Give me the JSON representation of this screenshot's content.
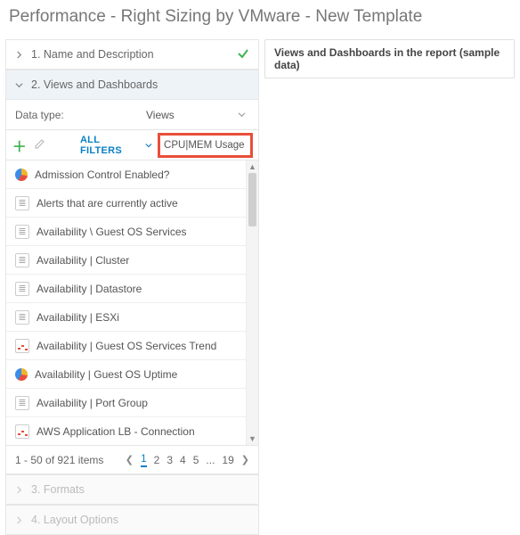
{
  "page_title": "Performance - Right Sizing by VMware - New Template",
  "right_panel_header": "Views and Dashboards in the report (sample data)",
  "steps": {
    "s1": {
      "label": "1. Name and Description",
      "complete": true,
      "expanded": false
    },
    "s2": {
      "label": "2. Views and Dashboards",
      "complete": false,
      "expanded": true
    },
    "s3": {
      "label": "3. Formats"
    },
    "s4": {
      "label": "4. Layout Options"
    }
  },
  "data_type": {
    "label": "Data type:",
    "value": "Views"
  },
  "filters": {
    "all_filters_label": "ALL FILTERS",
    "search_value": "CPU|MEM Usage"
  },
  "list": [
    {
      "icon": "pie",
      "label": "Admission Control Enabled?"
    },
    {
      "icon": "doc",
      "label": "Alerts that are currently active"
    },
    {
      "icon": "doc",
      "label": "Availability \\ Guest OS Services"
    },
    {
      "icon": "doc",
      "label": "Availability | Cluster"
    },
    {
      "icon": "doc",
      "label": "Availability | Datastore"
    },
    {
      "icon": "doc",
      "label": "Availability | ESXi"
    },
    {
      "icon": "chart",
      "label": "Availability | Guest OS Services Trend"
    },
    {
      "icon": "pie",
      "label": "Availability | Guest OS Uptime"
    },
    {
      "icon": "doc",
      "label": "Availability | Port Group"
    },
    {
      "icon": "chart",
      "label": "AWS Application LB - Connection"
    }
  ],
  "pager": {
    "status": "1 - 50 of 921 items",
    "pages": [
      "1",
      "2",
      "3",
      "4",
      "5",
      "...",
      "19"
    ],
    "current": "1"
  }
}
